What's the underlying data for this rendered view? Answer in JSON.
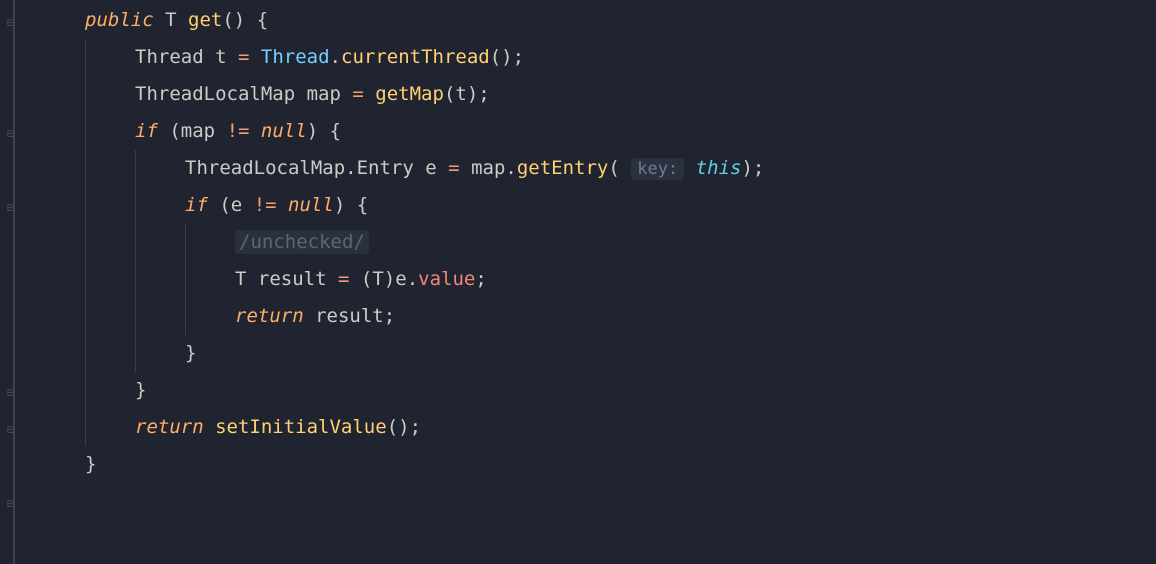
{
  "code": {
    "kw_public": "public",
    "type_T": "T",
    "method_get": "get",
    "open_paren": "(",
    "close_paren": ")",
    "space": " ",
    "open_brace": "{",
    "close_brace": "}",
    "type_Thread": "Thread",
    "var_t": "t",
    "eq": "=",
    "dot": ".",
    "method_currentThread": "currentThread",
    "semi": ";",
    "type_ThreadLocalMap": "ThreadLocalMap",
    "var_map": "map",
    "method_getMap": "getMap",
    "kw_if": "if",
    "op_neq": "!=",
    "kw_null": "null",
    "type_Entry": "Entry",
    "var_e": "e",
    "method_getEntry": "getEntry",
    "hint_key": "key:",
    "kw_this": "this",
    "comment_unchecked": "/unchecked/",
    "var_result": "result",
    "field_value": "value",
    "kw_return": "return",
    "method_setInitialValue": "setInitialValue"
  }
}
